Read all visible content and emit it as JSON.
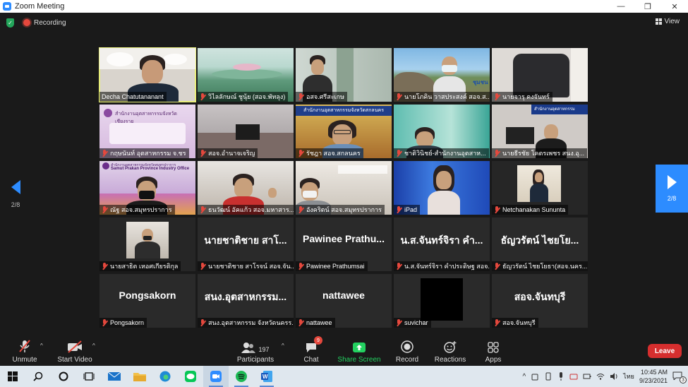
{
  "window": {
    "title": "Zoom Meeting",
    "controls": [
      "—",
      "❐",
      "✕"
    ]
  },
  "topbar": {
    "recording_label": "Recording",
    "view_label": "View"
  },
  "pagination": {
    "left": "2/8",
    "right": "2/8"
  },
  "participants_grid": [
    {
      "label": "Decha Chatutananant",
      "active": true,
      "muted": false,
      "kind": "video"
    },
    {
      "label": "วิไลลักษณ์ ชูนุ้ย (สอจ.พัทลุง)",
      "muted": true,
      "kind": "video"
    },
    {
      "label": "อสจ.ศรีสะเกษ",
      "muted": true,
      "kind": "video"
    },
    {
      "label": "นายโภคิน วาสประสงค์ สอจ.ส...",
      "muted": true,
      "kind": "video"
    },
    {
      "label": "นายจารุ คงจันทร์",
      "muted": true,
      "kind": "video"
    },
    {
      "label": "กฤษนันท์ อุตสาหกรรม จ.ชร",
      "muted": true,
      "kind": "video"
    },
    {
      "label": "สอจ.อำนาจเจริญ",
      "muted": true,
      "kind": "video"
    },
    {
      "label": "รัชฎา สอจ.สกลนคร",
      "muted": true,
      "kind": "video"
    },
    {
      "label": "ชาติวินิชย์-สำนักงานอุตสาห...",
      "muted": true,
      "kind": "video"
    },
    {
      "label": "นายธีรชัย โคตรเพชร สนง.อุ...",
      "muted": true,
      "kind": "video"
    },
    {
      "label": "ณัฐ สอจ.สมุทรปราการ",
      "muted": true,
      "kind": "video"
    },
    {
      "label": "ธนวัฒน์ อัคแก้ว สอจ.มหาสาร...",
      "muted": true,
      "kind": "video"
    },
    {
      "label": "อังคริตน์ สอจ.สมุทรปราการ",
      "muted": true,
      "kind": "video"
    },
    {
      "label": "iPad",
      "muted": true,
      "kind": "video"
    },
    {
      "label": "Netchanakan Sununta",
      "muted": true,
      "kind": "video"
    },
    {
      "label": "นายสาธิต เหอศเกียรติกุล",
      "muted": true,
      "kind": "video"
    },
    {
      "label": "นายชาติชาย สาโรจน์ สอจ.จัน...",
      "muted": true,
      "kind": "name",
      "display_name": "นายชาติชาย สาโ..."
    },
    {
      "label": "Pawinee Prathumsai",
      "muted": true,
      "kind": "name",
      "display_name": "Pawinee  Prathu..."
    },
    {
      "label": "น.ส.จันทร์จิรา คำประดิษฐ สอจ....",
      "muted": true,
      "kind": "name",
      "display_name": "น.ส.จันทร์จิรา คำ..."
    },
    {
      "label": "ธัญวรัตน์ ไชยโยธา(สอจ.นคร...",
      "muted": true,
      "kind": "name",
      "display_name": "ธัญวรัตน์  ไชยโย..."
    },
    {
      "label": "Pongsakorn",
      "muted": true,
      "kind": "name",
      "display_name": "Pongsakorn"
    },
    {
      "label": "สนง.อุตสาหกรรม จังหวัดนครร...",
      "muted": true,
      "kind": "name",
      "display_name": "สนง.อุตสาหกรรม..."
    },
    {
      "label": "nattawee",
      "muted": true,
      "kind": "name",
      "display_name": "nattawee"
    },
    {
      "label": "suvichar",
      "muted": true,
      "kind": "black"
    },
    {
      "label": "สอจ.จันทบุรี",
      "muted": true,
      "kind": "name",
      "display_name": "สอจ.จันทบุรี"
    }
  ],
  "video_banners": {
    "t7": "สำนักงานอุตสาหกรรมจังหวัดสกลนคร",
    "t10": "สำนักงานอุตสาหกรรมจังหวัดสมุทรปราการ",
    "t10b": "Samut Prakan Province Industry Office",
    "t5": "สำนักงานอุตสาหกรรมจังหวัดเชียงราย",
    "t3": "ชุมชน"
  },
  "toolbar": {
    "unmute": "Unmute",
    "start_video": "Start Video",
    "participants": "Participants",
    "participants_count": "197",
    "chat": "Chat",
    "chat_badge": "9",
    "share_screen": "Share Screen",
    "record": "Record",
    "reactions": "Reactions",
    "apps": "Apps",
    "leave": "Leave"
  },
  "taskbar": {
    "time": "10:45 AM",
    "date": "9/23/2021",
    "language": "ไทย",
    "notification_count": "3"
  },
  "colors": {
    "accent": "#2d8cff",
    "leave": "#d62e2e",
    "share": "#23d160",
    "active_border": "#e8ee7a"
  }
}
